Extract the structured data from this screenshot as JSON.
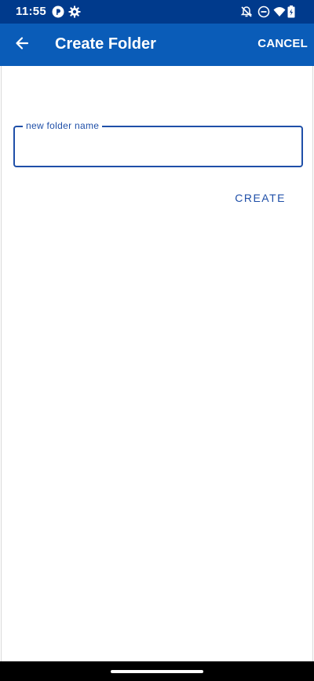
{
  "status_bar": {
    "time": "11:55",
    "icons": [
      "pocketcasts-icon",
      "settings-gear-icon",
      "notifications-off-icon",
      "do-not-disturb-icon",
      "wifi-icon",
      "battery-charging-icon"
    ]
  },
  "app_bar": {
    "title": "Create Folder",
    "cancel_label": "CANCEL",
    "back_icon": "arrow-back-icon"
  },
  "form": {
    "folder_name_label": "new folder name",
    "folder_name_value": "",
    "create_label": "CREATE"
  },
  "colors": {
    "status_bar": "#003a8c",
    "app_bar": "#0a5cb8",
    "accent": "#1f4fa8"
  }
}
